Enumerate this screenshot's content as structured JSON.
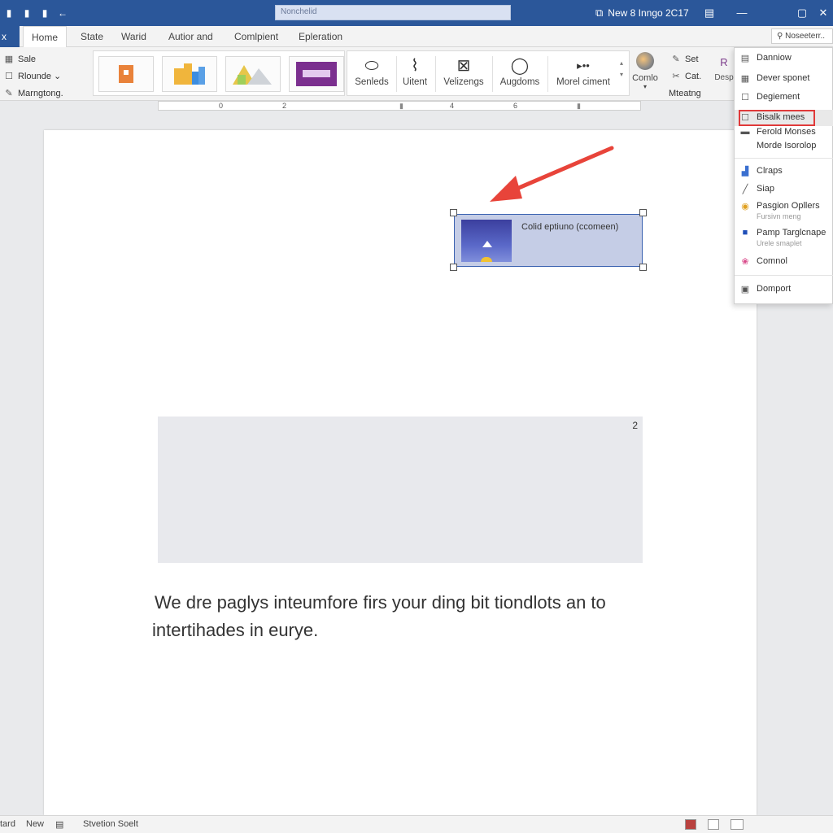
{
  "titlebar": {
    "search_text": "Nonchelid",
    "doc_title": "New 8 Inngo 2C17",
    "quick_icons": [
      "▮",
      "▮",
      "▮",
      "←"
    ]
  },
  "tabs": {
    "file": "x",
    "items": [
      "Home",
      "State",
      "Warid",
      "Autior and",
      "Comlpient",
      "Epleration"
    ],
    "share": "Noseeterr.."
  },
  "ribbon": {
    "clipboard": [
      "Sale",
      "Rlounde ⌄",
      "Marngtong."
    ],
    "tools": [
      "Senleds",
      "Uitent",
      "Velizengs",
      "Augdoms",
      "Morel ciment"
    ],
    "combo": "Comlo",
    "editing": [
      "Set",
      "Cat.",
      "Mteatng"
    ],
    "design_label": "Desp",
    "design_mark": "R"
  },
  "ruler": {
    "ticks": [
      "0",
      "2",
      "4",
      "6"
    ]
  },
  "document": {
    "image_caption": "Colid eptiuno (ccomeen)",
    "page_number": "2",
    "body_line1": "We dre paglys inteumfore firs your ding bit tiondlots an to",
    "body_line2": "intertihades in eurye."
  },
  "menu": {
    "items": [
      {
        "label": "Danniow",
        "icon": "layout-icon"
      },
      {
        "label": "Dever sponet",
        "icon": "grid-icon"
      },
      {
        "label": "Degiement",
        "icon": "checkbox-icon"
      },
      {
        "label": "Bisalk mees",
        "icon": "checkbox-icon",
        "highlighted": true
      },
      {
        "label": "Ferold Monses",
        "icon": "table-icon"
      },
      {
        "label": "Morde Isorolop",
        "icon": ""
      },
      {
        "label": "Clraps",
        "icon": "chart-icon"
      },
      {
        "label": "Siap",
        "icon": "line-icon"
      },
      {
        "label": "Pasgion Opllers",
        "sub": "Fursivn meng",
        "icon": "chrome-icon"
      },
      {
        "label": "Pamp Targlcnape",
        "sub": "Urele smaplet",
        "icon": "blue-square-icon"
      },
      {
        "label": "Comnol",
        "icon": "color-wheel-icon"
      },
      {
        "label": "Domport",
        "icon": "picture-icon"
      }
    ],
    "highlight_color": "#e03a3a"
  },
  "status": {
    "left1": "tard",
    "left2": "New",
    "left3": "Stvetion Soelt"
  },
  "colors": {
    "titlebar": "#2b579a",
    "arrow": "#e8443a",
    "selection_fill": "#c5cde6"
  }
}
